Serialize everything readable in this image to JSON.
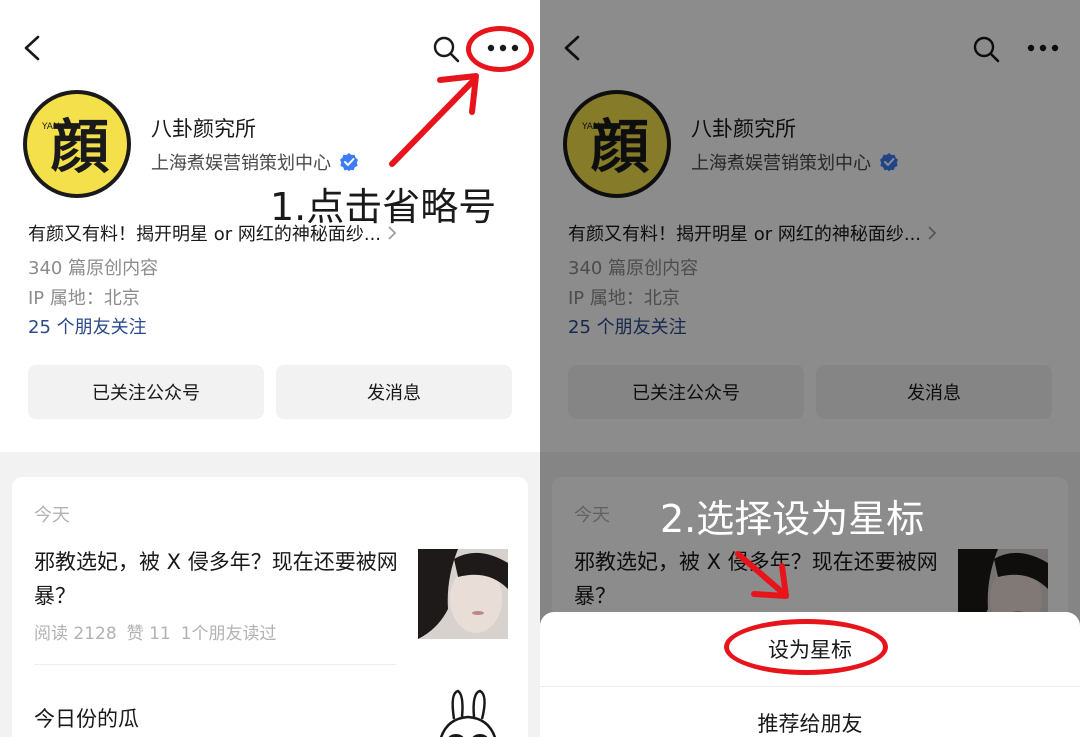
{
  "account": {
    "name": "八卦颜究所",
    "org": "上海煮娱营销策划中心",
    "logo_char": "顔",
    "logo_letters": "YAN",
    "intro": "有颜又有料！揭开明星 or 网红的神秘面纱...",
    "stats_original": "340 篇原创内容",
    "ip_location": "IP 属地：北京",
    "friends_follow": "25 个朋友关注"
  },
  "buttons": {
    "follow_label": "已关注公众号",
    "message_label": "发消息"
  },
  "feed": {
    "date_label": "今天",
    "article1": {
      "title": "邪教选妃，被 X 侵多年？现在还要被网暴？",
      "reads": "阅读 2128",
      "likes": "赞 11",
      "friends_read": "1个朋友读过"
    },
    "article2": {
      "title": "今日份的瓜"
    }
  },
  "annotations": {
    "step1": "1.点击省略号",
    "step2": "2.选择设为星标"
  },
  "sheet": {
    "star_label": "设为星标",
    "recommend_label": "推荐给朋友"
  },
  "colors": {
    "accent_red": "#e8141c",
    "logo_yellow": "#f3e04a",
    "link_blue": "#2b4a8b",
    "verified_blue": "#3c7df5"
  },
  "icons": [
    "back-icon",
    "search-icon",
    "more-icon",
    "verified-icon",
    "chevron-right-icon"
  ]
}
